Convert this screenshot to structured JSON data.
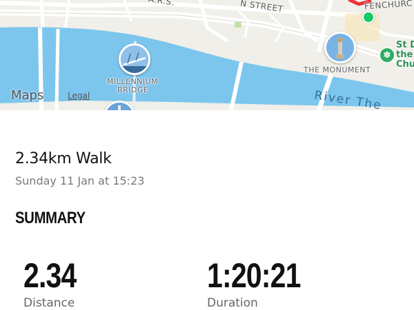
{
  "map": {
    "labels": {
      "street_top_left": "A.R.S.",
      "street_top_mid": "N STREET",
      "street_top_right": "FENCHURC",
      "millennium_line1": "MILLENNIUM",
      "millennium_line2": "BRIDGE",
      "monument": "THE MONUMENT",
      "church_line1": "St D",
      "church_line2": "the",
      "church_line3": "Chu",
      "river": "River The"
    },
    "attribution": {
      "brand": "Maps",
      "legal": "Legal"
    },
    "colors": {
      "water": "#7cc6ee",
      "land": "#f1efe9",
      "route": "#e8343a",
      "start": "#17c964"
    }
  },
  "workout": {
    "title": "2.34km Walk",
    "date": "Sunday 11 Jan at 15:23"
  },
  "summary": {
    "heading": "SUMMARY",
    "stats": [
      {
        "value": "2.34",
        "label": "Distance"
      },
      {
        "value": "1:20:21",
        "label": "Duration"
      }
    ]
  }
}
